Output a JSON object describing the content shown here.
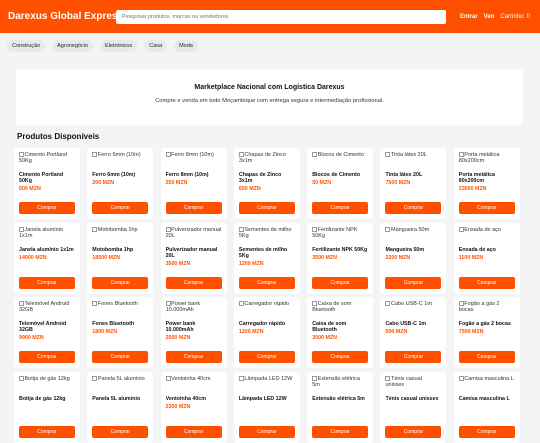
{
  "header": {
    "brand": "Darexus Global Express",
    "search_placeholder": "Pesquisar produtos, marcas ou vendedores",
    "enter": "Entrar",
    "sell": "Ven",
    "cart": "Carrinho: 0"
  },
  "categories": [
    "Construção",
    "Agronegócio",
    "Eletrónicos",
    "Casa",
    "Moda"
  ],
  "hero": {
    "title": "Marketplace Nacional com Logística Darexus",
    "subtitle": "Compre e venda em todo Moçambique com entrega segura e intermediação profissional."
  },
  "products_title": "Produtos Disponíveis",
  "buy_label": "Comprar",
  "products": [
    {
      "img_alt": "Cimento Portland 50Kg",
      "name": "Cimento Portland 50Kg",
      "price": "500 MZN"
    },
    {
      "img_alt": "Ferro 6mm (10m)",
      "name": "Ferro 6mm (10m)",
      "price": "200 MZN"
    },
    {
      "img_alt": "Ferro 8mm (10m)",
      "name": "Ferro 8mm (10m)",
      "price": "250 MZN"
    },
    {
      "img_alt": "Chapas de Zinco 3x1m",
      "name": "Chapas de Zinco 3x1m",
      "price": "650 MZN"
    },
    {
      "img_alt": "Blocos de Cimento",
      "name": "Blocos de Cimento",
      "price": "50 MZN"
    },
    {
      "img_alt": "Tinta látex 20L",
      "name": "Tinta látex 20L",
      "price": "7500 MZN"
    },
    {
      "img_alt": "Porta metálica 80x200cm",
      "name": "Porta metálica 80x200cm",
      "price": "23000 MZN"
    },
    {
      "img_alt": "Janela alumínio 1x1m",
      "name": "Janela alumínio 1x1m",
      "price": "14000 MZN"
    },
    {
      "img_alt": "Motobomba 1hp",
      "name": "Motobomba 1hp",
      "price": "18500 MZN"
    },
    {
      "img_alt": "Pulverizador manual 20L",
      "name": "Pulverizador manual 20L",
      "price": "3500 MZN"
    },
    {
      "img_alt": "Sementes de milho 5Kg",
      "name": "Sementes de milho 5Kg",
      "price": "1200 MZN"
    },
    {
      "img_alt": "Fertilizante NPK 50Kg",
      "name": "Fertilizante NPK 50Kg",
      "price": "3500 MZN"
    },
    {
      "img_alt": "Mangueira 50m",
      "name": "Mangueira 50m",
      "price": "2200 MZN"
    },
    {
      "img_alt": "Enxada de aço",
      "name": "Enxada de aço",
      "price": "1100 MZN"
    },
    {
      "img_alt": "Telemóvel Android 32GB",
      "name": "Telemóvel Android 32GB",
      "price": "9900 MZN"
    },
    {
      "img_alt": "Fones Bluetooth",
      "name": "Fones Bluetooth",
      "price": "1800 MZN"
    },
    {
      "img_alt": "Power bank 10.000mAh",
      "name": "Power bank 10.000mAh",
      "price": "2500 MZN"
    },
    {
      "img_alt": "Carregador rápido",
      "name": "Carregador rápido",
      "price": "1200 MZN"
    },
    {
      "img_alt": "Caixa de som Bluetooth",
      "name": "Caixa de som Bluetooth",
      "price": "3000 MZN"
    },
    {
      "img_alt": "Cabo USB-C 1m",
      "name": "Cabo USB-C 1m",
      "price": "500 MZN"
    },
    {
      "img_alt": "Fogão a gás 2 bocas",
      "name": "Fogão a gás 2 bocas",
      "price": "7500 MZN"
    },
    {
      "img_alt": "Botija de gás 12kg",
      "name": "Botija de gás 12kg",
      "price": ""
    },
    {
      "img_alt": "Panela 5L alumínio",
      "name": "Panela 5L alumínio",
      "price": ""
    },
    {
      "img_alt": "Ventoinha 40cm",
      "name": "Ventoinha 40cm",
      "price": "2300 MZN"
    },
    {
      "img_alt": "Lâmpada LED 12W",
      "name": "Lâmpada LED 12W",
      "price": ""
    },
    {
      "img_alt": "Extensão elétrica 5m",
      "name": "Extensão elétrica 5m",
      "price": ""
    },
    {
      "img_alt": "Ténis casual unissex",
      "name": "Ténis casual unissex",
      "price": ""
    },
    {
      "img_alt": "Camisa masculina L",
      "name": "Camisa masculina L",
      "price": ""
    }
  ]
}
